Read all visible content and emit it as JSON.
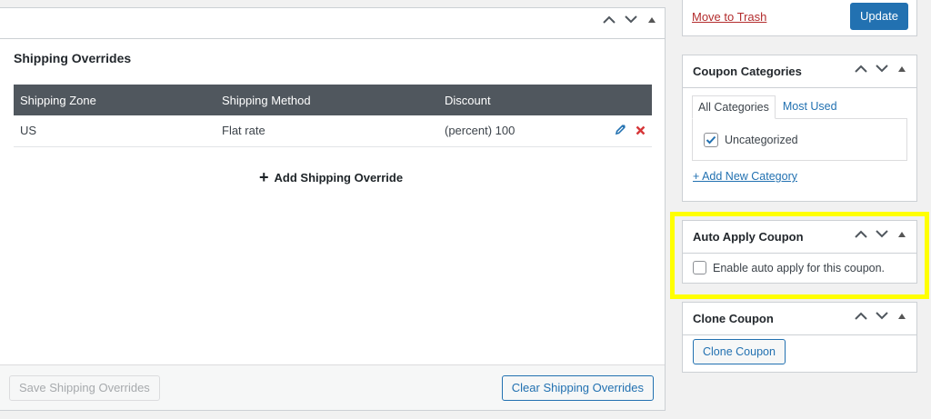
{
  "publish": {
    "trash_label": "Move to Trash",
    "update_label": "Update"
  },
  "shipping": {
    "title": "Shipping Overrides",
    "columns": [
      "Shipping Zone",
      "Shipping Method",
      "Discount"
    ],
    "rows": [
      {
        "zone": "US",
        "method": "Flat rate",
        "discount": "(percent) 100"
      }
    ],
    "add_label": "Add Shipping Override",
    "save_label": "Save Shipping Overrides",
    "clear_label": "Clear Shipping Overrides"
  },
  "categories": {
    "title": "Coupon Categories",
    "tabs": [
      "All Categories",
      "Most Used"
    ],
    "items": [
      {
        "label": "Uncategorized",
        "checked": true
      }
    ],
    "add_label": "+ Add New Category"
  },
  "auto_apply": {
    "title": "Auto Apply Coupon",
    "checkbox_label": "Enable auto apply for this coupon.",
    "checked": false
  },
  "clone": {
    "title": "Clone Coupon",
    "button_label": "Clone Coupon"
  },
  "colors": {
    "accent": "#2271b1",
    "danger": "#b32d2e",
    "highlight": "#ffff00",
    "table_header": "#50575e"
  },
  "icons": {
    "up": "chevron-up-icon",
    "down": "chevron-down-icon",
    "toggle": "triangle-up-icon",
    "edit": "pencil-icon",
    "delete": "close-icon",
    "check": "checkmark-icon",
    "add": "plus-icon"
  }
}
